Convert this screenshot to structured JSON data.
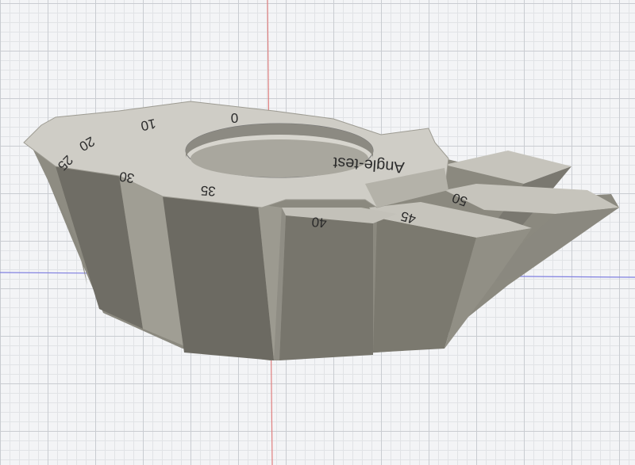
{
  "viewport": {
    "background_color": "#f3f4f6",
    "grid_major_color": "#c9ccd1",
    "grid_minor_color": "#e1e3e6",
    "axis_x_color": "#7f7fe0",
    "axis_y_color": "#e07f7f"
  },
  "model": {
    "name": "Angle-test",
    "top_face_color": "#cfcdc6",
    "side_light_color": "#a3a197",
    "side_dark_color": "#6d6b63",
    "hole_color": "#8c8a82",
    "engraving_color": "#2b2b2b",
    "angle_marks": [
      "0",
      "10",
      "20",
      "25",
      "30",
      "35",
      "40",
      "45",
      "50"
    ]
  }
}
